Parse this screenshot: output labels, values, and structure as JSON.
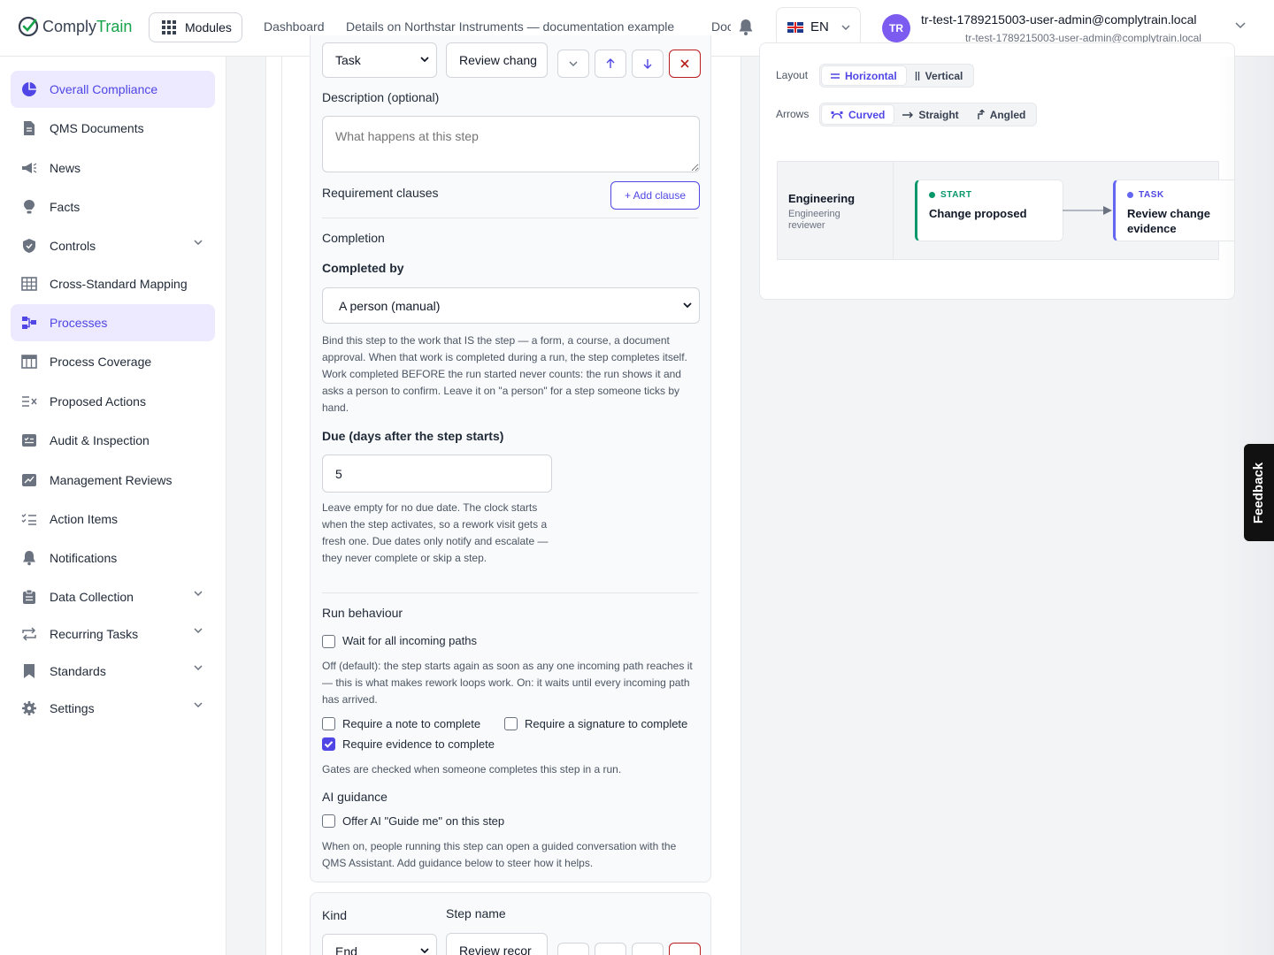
{
  "app": {
    "logo_left": "Comply",
    "logo_right": "Train"
  },
  "header": {
    "modules_label": "Modules",
    "breadcrumb_dashboard": "Dashboard",
    "breadcrumb_process": "Details on Northstar Instruments — documentation example",
    "breadcrumb_truncated": "Doc",
    "language": "EN",
    "avatar_initials": "TR",
    "user_name": "tr-test-1789215003-user-admin@complytrain.local",
    "user_email": "tr-test-1789215003-user-admin@complytrain.local"
  },
  "sidebar": {
    "items": [
      {
        "label": "Overall Compliance",
        "icon": "pie-chart-icon",
        "active": true
      },
      {
        "label": "QMS Documents",
        "icon": "document-icon"
      },
      {
        "label": "News",
        "icon": "megaphone-icon"
      },
      {
        "label": "Facts",
        "icon": "lightbulb-icon"
      },
      {
        "label": "Controls",
        "icon": "shield-icon",
        "expandable": true
      },
      {
        "label": "Cross-Standard Mapping",
        "icon": "table-grid-icon"
      },
      {
        "label": "Processes",
        "icon": "flow-icon",
        "active": true
      },
      {
        "label": "Process Coverage",
        "icon": "coverage-table-icon"
      },
      {
        "label": "Proposed Actions",
        "icon": "list-x-icon"
      },
      {
        "label": "Audit & Inspection",
        "icon": "checklist-board-icon"
      },
      {
        "label": "Management Reviews",
        "icon": "chart-board-icon"
      },
      {
        "label": "Action Items",
        "icon": "checklist-icon"
      },
      {
        "label": "Notifications",
        "icon": "bell-icon"
      },
      {
        "label": "Data Collection",
        "icon": "clipboard-icon",
        "expandable": true
      },
      {
        "label": "Recurring Tasks",
        "icon": "repeat-icon",
        "expandable": true
      },
      {
        "label": "Standards",
        "icon": "bookmark-icon",
        "expandable": true
      },
      {
        "label": "Settings",
        "icon": "gear-icon",
        "expandable": true
      }
    ]
  },
  "step_editor": {
    "kind_value": "Task",
    "step_name_value": "Review chang",
    "description_label": "Description (optional)",
    "description_placeholder": "What happens at this step",
    "requirement_clauses_label": "Requirement clauses",
    "add_clause_label": "+ Add clause",
    "completion_heading": "Completion",
    "completed_by_label": "Completed by",
    "completed_by_value": "A person (manual)",
    "completed_by_help": "Bind this step to the work that IS the step — a form, a course, a document approval. When that work is completed during a run, the step completes itself. Work completed BEFORE the run started never counts: the run shows it and asks a person to confirm. Leave it on \"a person\" for a step someone ticks by hand.",
    "due_label": "Due (days after the step starts)",
    "due_value": "5",
    "due_help": "Leave empty for no due date. The clock starts when the step activates, so a rework visit gets a fresh one. Due dates only notify and escalate — they never complete or skip a step.",
    "run_behaviour_heading": "Run behaviour",
    "wait_all_label": "Wait for all incoming paths",
    "wait_all_help": "Off (default): the step starts again as soon as any one incoming path reaches it — this is what makes rework loops work. On: it waits until every incoming path has arrived.",
    "require_note_label": "Require a note to complete",
    "require_signature_label": "Require a signature to complete",
    "require_evidence_label": "Require evidence to complete",
    "gates_help": "Gates are checked when someone completes this step in a run.",
    "ai_heading": "AI guidance",
    "ai_offer_label": "Offer AI \"Guide me\" on this step",
    "ai_help": "When on, people running this step can open a guided conversation with the QMS Assistant. Add guidance below to steer how it helps."
  },
  "next_step": {
    "kind_label": "Kind",
    "step_name_label": "Step name",
    "kind_value": "End",
    "step_name_value": "Review recor"
  },
  "preview": {
    "layout_label": "Layout",
    "layout_options": [
      "Horizontal",
      "Vertical"
    ],
    "arrows_label": "Arrows",
    "arrow_options": [
      "Curved",
      "Straight",
      "Angled"
    ],
    "lane_title": "Engineering",
    "lane_subtitle": "Engineering reviewer",
    "nodes": [
      {
        "kind": "START",
        "title": "Change proposed",
        "color": "#059669"
      },
      {
        "kind": "TASK",
        "title": "Review change evidence",
        "color": "#6366f1"
      }
    ]
  },
  "feedback_label": "Feedback",
  "colors": {
    "accent": "#4f46e5",
    "brand_green": "#16a34a",
    "danger": "#b91c1c"
  }
}
